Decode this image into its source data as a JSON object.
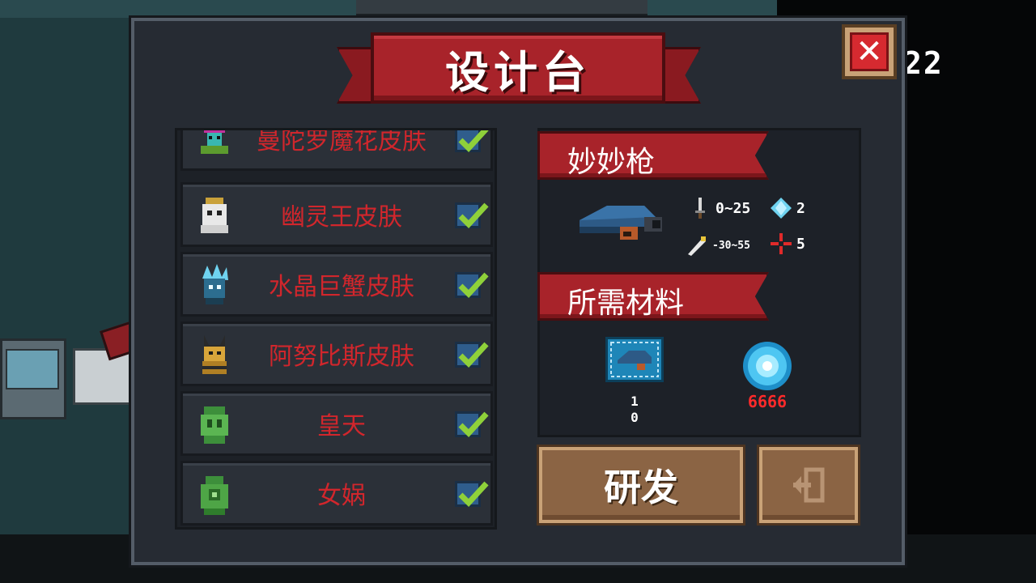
{
  "hud": {
    "timer": "22"
  },
  "window": {
    "title": "设计台",
    "close_glyph": "✕"
  },
  "skins": [
    {
      "name": "曼陀罗魔花皮肤",
      "checked": true,
      "icon": "flower-skin-icon"
    },
    {
      "name": "幽灵王皮肤",
      "checked": true,
      "icon": "ghost-king-skin-icon"
    },
    {
      "name": "水晶巨蟹皮肤",
      "checked": true,
      "icon": "crystal-crab-skin-icon"
    },
    {
      "name": "阿努比斯皮肤",
      "checked": true,
      "icon": "anubis-skin-icon"
    },
    {
      "name": "皇天",
      "checked": true,
      "icon": "huangtian-skin-icon"
    },
    {
      "name": "女娲",
      "checked": true,
      "icon": "nuwa-skin-icon"
    }
  ],
  "weapon": {
    "name": "妙妙枪",
    "damage": "0~25",
    "energy": "2",
    "spread": "-30~55",
    "crit": "5"
  },
  "materials": {
    "header": "所需材料",
    "blueprint_count": "1\n0",
    "gem_count": "6666"
  },
  "buttons": {
    "research": "研发",
    "exit_icon": "exit-door-icon"
  },
  "colors": {
    "accent_red": "#a8232a",
    "name_red": "#d1262c",
    "check_green": "#8fd13a",
    "wood": "#8b6444"
  }
}
